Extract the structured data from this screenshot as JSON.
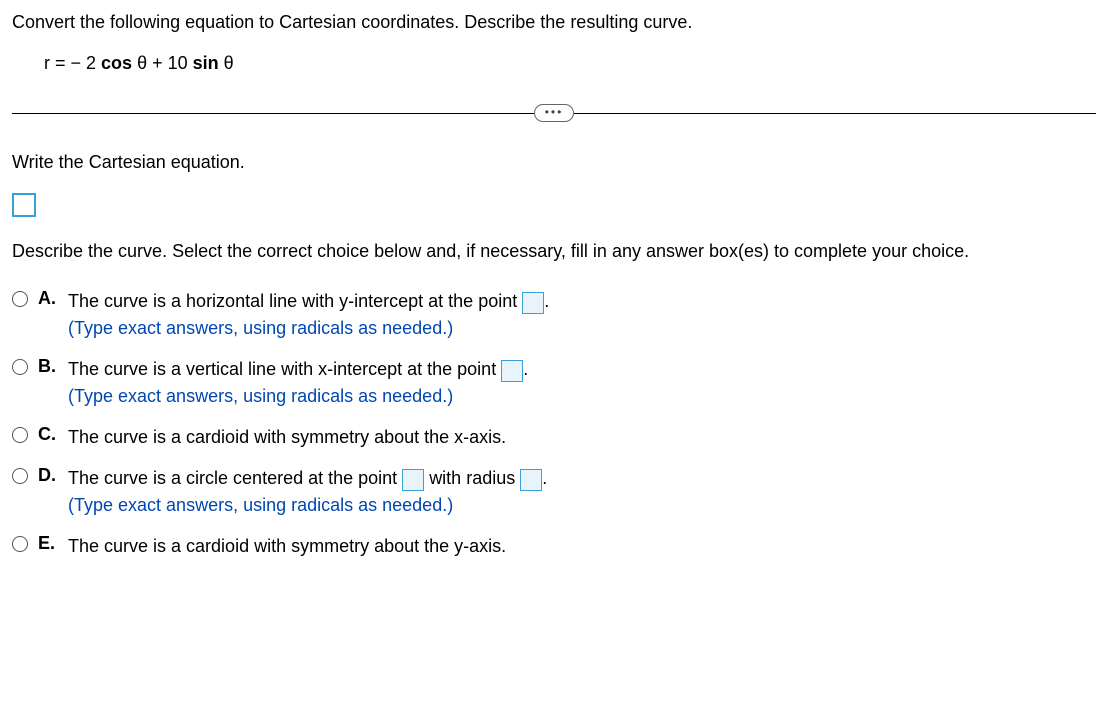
{
  "question": "Convert the following equation to Cartesian coordinates. Describe the resulting curve.",
  "equation": "r = − 2 cos θ + 10 sin θ",
  "prompt1": "Write the Cartesian equation.",
  "describe": "Describe the curve. Select the correct choice below and, if necessary, fill in any answer box(es) to complete your choice.",
  "hint": "(Type exact answers, using radicals as needed.)",
  "options": {
    "A": {
      "letter": "A.",
      "text1": "The curve is a horizontal line with y-intercept at the point ",
      "text2": "."
    },
    "B": {
      "letter": "B.",
      "text1": "The curve is a vertical line with x-intercept at the point ",
      "text2": "."
    },
    "C": {
      "letter": "C.",
      "text": "The curve is a cardioid with symmetry about the x-axis."
    },
    "D": {
      "letter": "D.",
      "text1": "The curve is a circle centered at the point ",
      "text2": " with radius ",
      "text3": "."
    },
    "E": {
      "letter": "E.",
      "text": "The curve is a cardioid with symmetry about the y-axis."
    }
  }
}
